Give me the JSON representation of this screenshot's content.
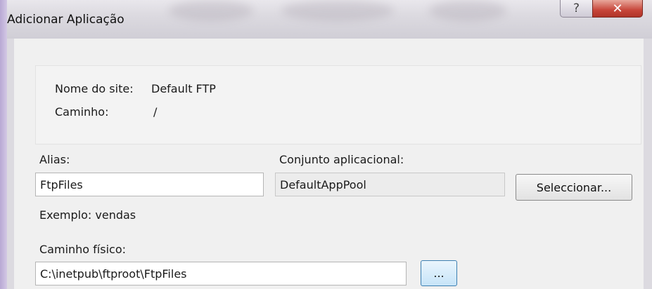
{
  "window": {
    "title": "Adicionar Aplicação",
    "help_glyph": "?",
    "close_glyph": "✕"
  },
  "info": {
    "site_name_label": "Nome do site:",
    "site_name_value": "Default FTP",
    "path_label": "Caminho:",
    "path_value": "/"
  },
  "form": {
    "alias_label": "Alias:",
    "alias_value": "FtpFiles",
    "alias_example": "Exemplo: vendas",
    "app_pool_label": "Conjunto aplicacional:",
    "app_pool_value": "DefaultAppPool",
    "select_button": "Seleccionar...",
    "physical_path_label": "Caminho físico:",
    "physical_path_value": "C:\\inetpub\\ftproot\\FtpFiles",
    "browse_button": "..."
  }
}
